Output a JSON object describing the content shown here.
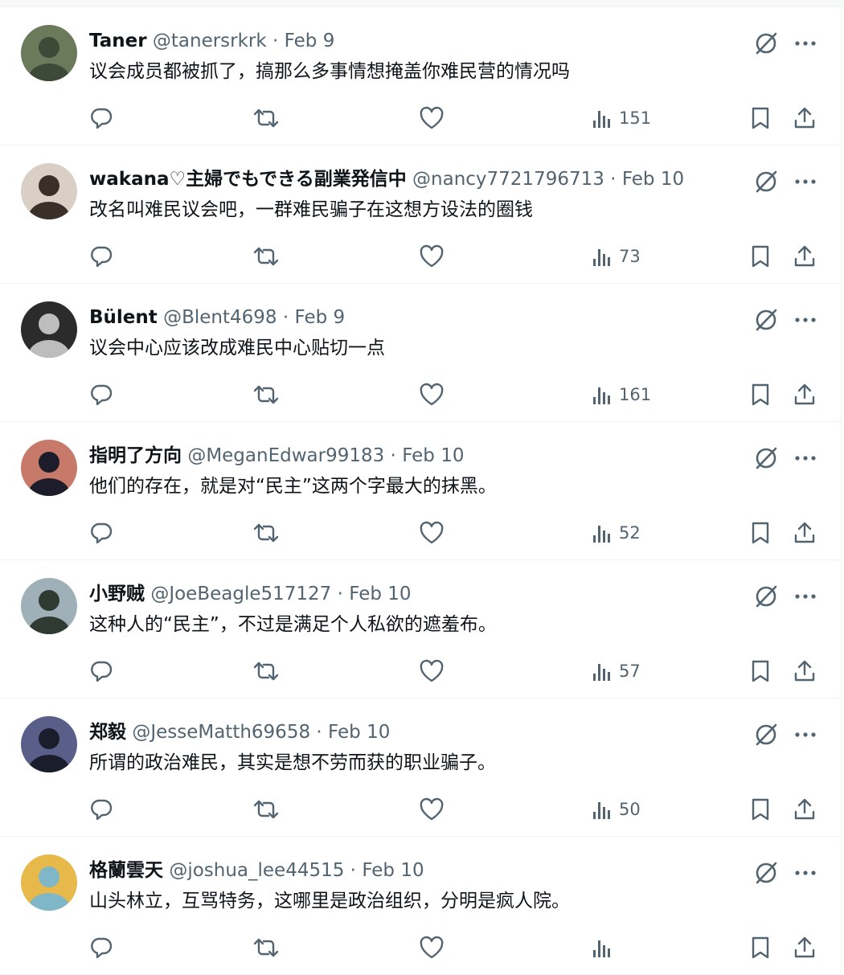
{
  "tweets": [
    {
      "name": "Taner",
      "handle": "@tanersrkrk",
      "date": "Feb 9",
      "text": "议会成员都被抓了，搞那么多事情想掩盖你难民营的情况吗",
      "views": "151",
      "avatar_colors": [
        "#6b7a5a",
        "#3d4a38"
      ]
    },
    {
      "name": "wakana♡主婦でもできる副業発信中",
      "handle": "@nancy7721796713",
      "date": "Feb 10",
      "text": "改名叫难民议会吧，一群难民骗子在这想方设法的圈钱",
      "views": "73",
      "avatar_colors": [
        "#d9cfc4",
        "#3a2e28"
      ]
    },
    {
      "name": "Bülent",
      "handle": "@Blent4698",
      "date": "Feb 9",
      "text": "议会中心应该改成难民中心贴切一点",
      "views": "161",
      "avatar_colors": [
        "#2b2b2b",
        "#bdbdbd"
      ]
    },
    {
      "name": "指明了方向",
      "handle": "@MeganEdwar99183",
      "date": "Feb 10",
      "text": "他们的存在，就是对“民主”这两个字最大的抹黑。",
      "views": "52",
      "avatar_colors": [
        "#c87a6a",
        "#1c1c2a"
      ]
    },
    {
      "name": "小野贼",
      "handle": "@JoeBeagle517127",
      "date": "Feb 10",
      "text": "这种人的“民主”，不过是满足个人私欲的遮羞布。",
      "views": "57",
      "avatar_colors": [
        "#9fb0b8",
        "#2f3a33"
      ]
    },
    {
      "name": "郑毅",
      "handle": "@JesseMatth69658",
      "date": "Feb 10",
      "text": "所谓的政治难民，其实是想不劳而获的职业骗子。",
      "views": "50",
      "avatar_colors": [
        "#5a5f8a",
        "#1a1d2b"
      ]
    },
    {
      "name": "格蘭雲天",
      "handle": "@joshua_lee44515",
      "date": "Feb 10",
      "text": "山头林立，互骂特务，这哪里是政治组织，分明是疯人院。",
      "views": "",
      "avatar_colors": [
        "#e7b84a",
        "#7fb7c9"
      ]
    }
  ],
  "separator": " · ",
  "icons": {
    "grok": "grok-icon",
    "more": "more-icon",
    "reply": "reply-icon",
    "retweet": "retweet-icon",
    "like": "like-icon",
    "views": "views-icon",
    "bookmark": "bookmark-icon",
    "share": "share-icon"
  },
  "colors": {
    "text": "#0f1419",
    "secondary": "#536471",
    "border": "#eff3f4"
  }
}
